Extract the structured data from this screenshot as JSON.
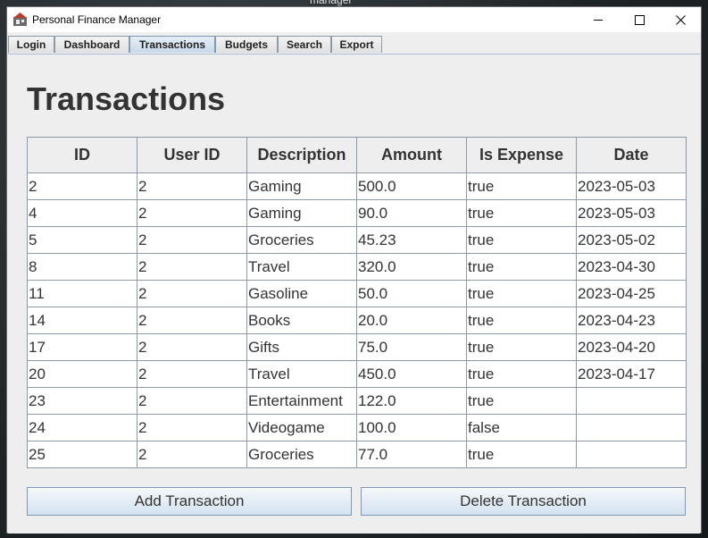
{
  "desktop": {
    "caption": "manager"
  },
  "window": {
    "title": "Personal Finance Manager"
  },
  "tabs": [
    {
      "label": "Login"
    },
    {
      "label": "Dashboard"
    },
    {
      "label": "Transactions",
      "active": true
    },
    {
      "label": "Budgets"
    },
    {
      "label": "Search"
    },
    {
      "label": "Export"
    }
  ],
  "page": {
    "title": "Transactions"
  },
  "table": {
    "columns": [
      "ID",
      "User ID",
      "Description",
      "Amount",
      "Is Expense",
      "Date"
    ],
    "rows": [
      [
        "2",
        "2",
        "Gaming",
        "500.0",
        "true",
        "2023-05-03"
      ],
      [
        "4",
        "2",
        "Gaming",
        "90.0",
        "true",
        "2023-05-03"
      ],
      [
        "5",
        "2",
        "Groceries",
        "45.23",
        "true",
        "2023-05-02"
      ],
      [
        "8",
        "2",
        "Travel",
        "320.0",
        "true",
        "2023-04-30"
      ],
      [
        "11",
        "2",
        "Gasoline",
        "50.0",
        "true",
        "2023-04-25"
      ],
      [
        "14",
        "2",
        "Books",
        "20.0",
        "true",
        "2023-04-23"
      ],
      [
        "17",
        "2",
        "Gifts",
        "75.0",
        "true",
        "2023-04-20"
      ],
      [
        "20",
        "2",
        "Travel",
        "450.0",
        "true",
        "2023-04-17"
      ],
      [
        "23",
        "2",
        "Entertainment",
        "122.0",
        "true",
        ""
      ],
      [
        "24",
        "2",
        "Videogame",
        "100.0",
        "false",
        ""
      ],
      [
        "25",
        "2",
        "Groceries",
        "77.0",
        "true",
        ""
      ]
    ]
  },
  "buttons": {
    "add_label": "Add Transaction",
    "delete_label": "Delete Transaction"
  },
  "icons": {
    "app": "app-icon",
    "minimize": "minimize-icon",
    "maximize": "maximize-icon",
    "close": "close-icon"
  }
}
